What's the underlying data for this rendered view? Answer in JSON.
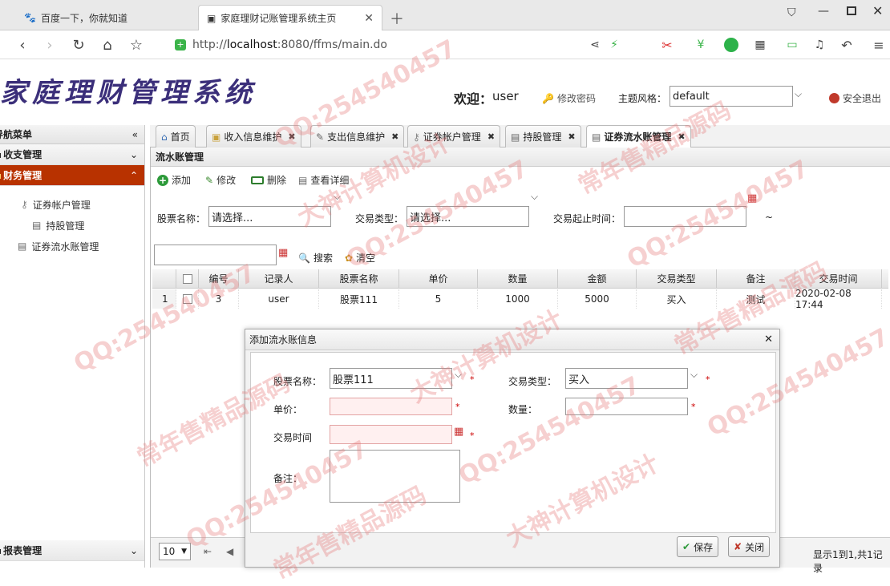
{
  "browser": {
    "tabs": [
      {
        "label": "百度一下，你就知道"
      },
      {
        "label": "家庭理财记账管理系统主页"
      }
    ],
    "url_prefix": "http://",
    "url_host": "localhost",
    "url_rest": ":8080/ffms/main.do"
  },
  "app": {
    "logo": "家庭理财管理系统",
    "welcome_label": "欢迎：",
    "user": "user",
    "change_password": "修改密码",
    "theme_label": "主题风格：",
    "theme_value": "default",
    "logout": "安全退出"
  },
  "sidebar": {
    "title": "导航菜单",
    "groups": [
      {
        "label": "收支管理"
      },
      {
        "label": "财务管理"
      }
    ],
    "items": [
      {
        "label": "证券帐户管理"
      },
      {
        "label": "持股管理"
      },
      {
        "label": "证券流水账管理"
      }
    ],
    "bottom_group": "报表管理"
  },
  "tabs": [
    {
      "label": "首页"
    },
    {
      "label": "收入信息维护"
    },
    {
      "label": "支出信息维护"
    },
    {
      "label": "证券帐户管理"
    },
    {
      "label": "持股管理"
    },
    {
      "label": "证券流水账管理"
    }
  ],
  "panel": {
    "title": "流水账管理",
    "toolbar": {
      "add": "添加",
      "edit": "修改",
      "delete": "删除",
      "detail": "查看详细"
    },
    "search": {
      "stock_label": "股票名称：",
      "stock_value": "请选择...",
      "type_label": "交易类型：",
      "type_value": "请选择...",
      "time_label": "交易起止时间：",
      "tilde": "~",
      "search_btn": "搜索",
      "clear_btn": "清空"
    },
    "grid": {
      "headers": [
        "编号",
        "记录人",
        "股票名称",
        "单价",
        "数量",
        "金额",
        "交易类型",
        "备注",
        "交易时间"
      ],
      "rows": [
        {
          "rownum": "1",
          "cells": [
            "3",
            "user",
            "股票111",
            "5",
            "1000",
            "5000",
            "买入",
            "测试",
            "2020-02-08 17:44"
          ]
        }
      ]
    },
    "pager": {
      "page_size": "10",
      "summary": "显示1到1,共1记录"
    }
  },
  "dialog": {
    "title": "添加流水账信息",
    "stock_label": "股票名称：",
    "stock_value": "股票111",
    "type_label": "交易类型：",
    "type_value": "买入",
    "price_label": "单价：",
    "qty_label": "数量：",
    "time_label": "交易时间",
    "remark_label": "备注：",
    "save": "保存",
    "close": "关闭",
    "required_mark": "*"
  },
  "watermarks": [
    "QQ:254540457",
    "常年售精品源码",
    "大神计算机设计"
  ],
  "colors": {
    "accent": "#b83200",
    "logo": "#3b2f7a",
    "watermark": "#e67878"
  }
}
